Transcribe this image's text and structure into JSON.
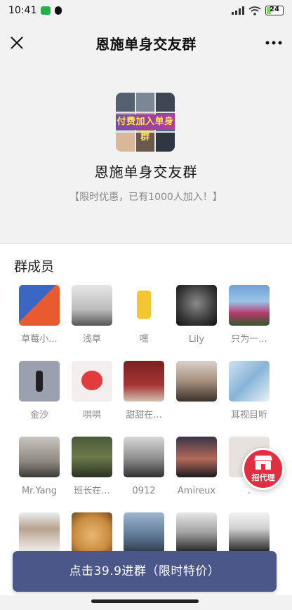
{
  "status_bar": {
    "time": "10:41",
    "battery": "24",
    "icons": [
      "wechat-icon",
      "qq-icon",
      "signal-icon",
      "wifi-icon",
      "battery-icon"
    ]
  },
  "nav": {
    "title": "恩施单身交友群",
    "close_icon": "close-icon",
    "more_icon": "more-icon"
  },
  "group": {
    "avatar_banner": "付费加入单身群",
    "name": "恩施单身交友群",
    "promo": "【限时优惠，已有1000人加入！】"
  },
  "members": {
    "title": "群成员",
    "items": [
      {
        "name": "草莓小..."
      },
      {
        "name": "浅草"
      },
      {
        "name": "嘿"
      },
      {
        "name": "Lily"
      },
      {
        "name": "只为一..."
      },
      {
        "name": "金沙"
      },
      {
        "name": "哄哄"
      },
      {
        "name": "甜甜在..."
      },
      {
        "name": ""
      },
      {
        "name": "耳视目听"
      },
      {
        "name": "Mr.Yang"
      },
      {
        "name": "班长在..."
      },
      {
        "name": "0912"
      },
      {
        "name": "Amireux"
      },
      {
        "name": "."
      },
      {
        "name": ""
      },
      {
        "name": ""
      },
      {
        "name": ""
      },
      {
        "name": ""
      },
      {
        "name": ""
      }
    ]
  },
  "cta": {
    "label": "点击39.9进群（限时特价）"
  },
  "agent_badge": {
    "label": "招代理",
    "icon": "store-icon"
  },
  "colors": {
    "cta_background": "#4a5788",
    "badge_background": "#e02e43",
    "header_background": "#f2f2f2"
  }
}
